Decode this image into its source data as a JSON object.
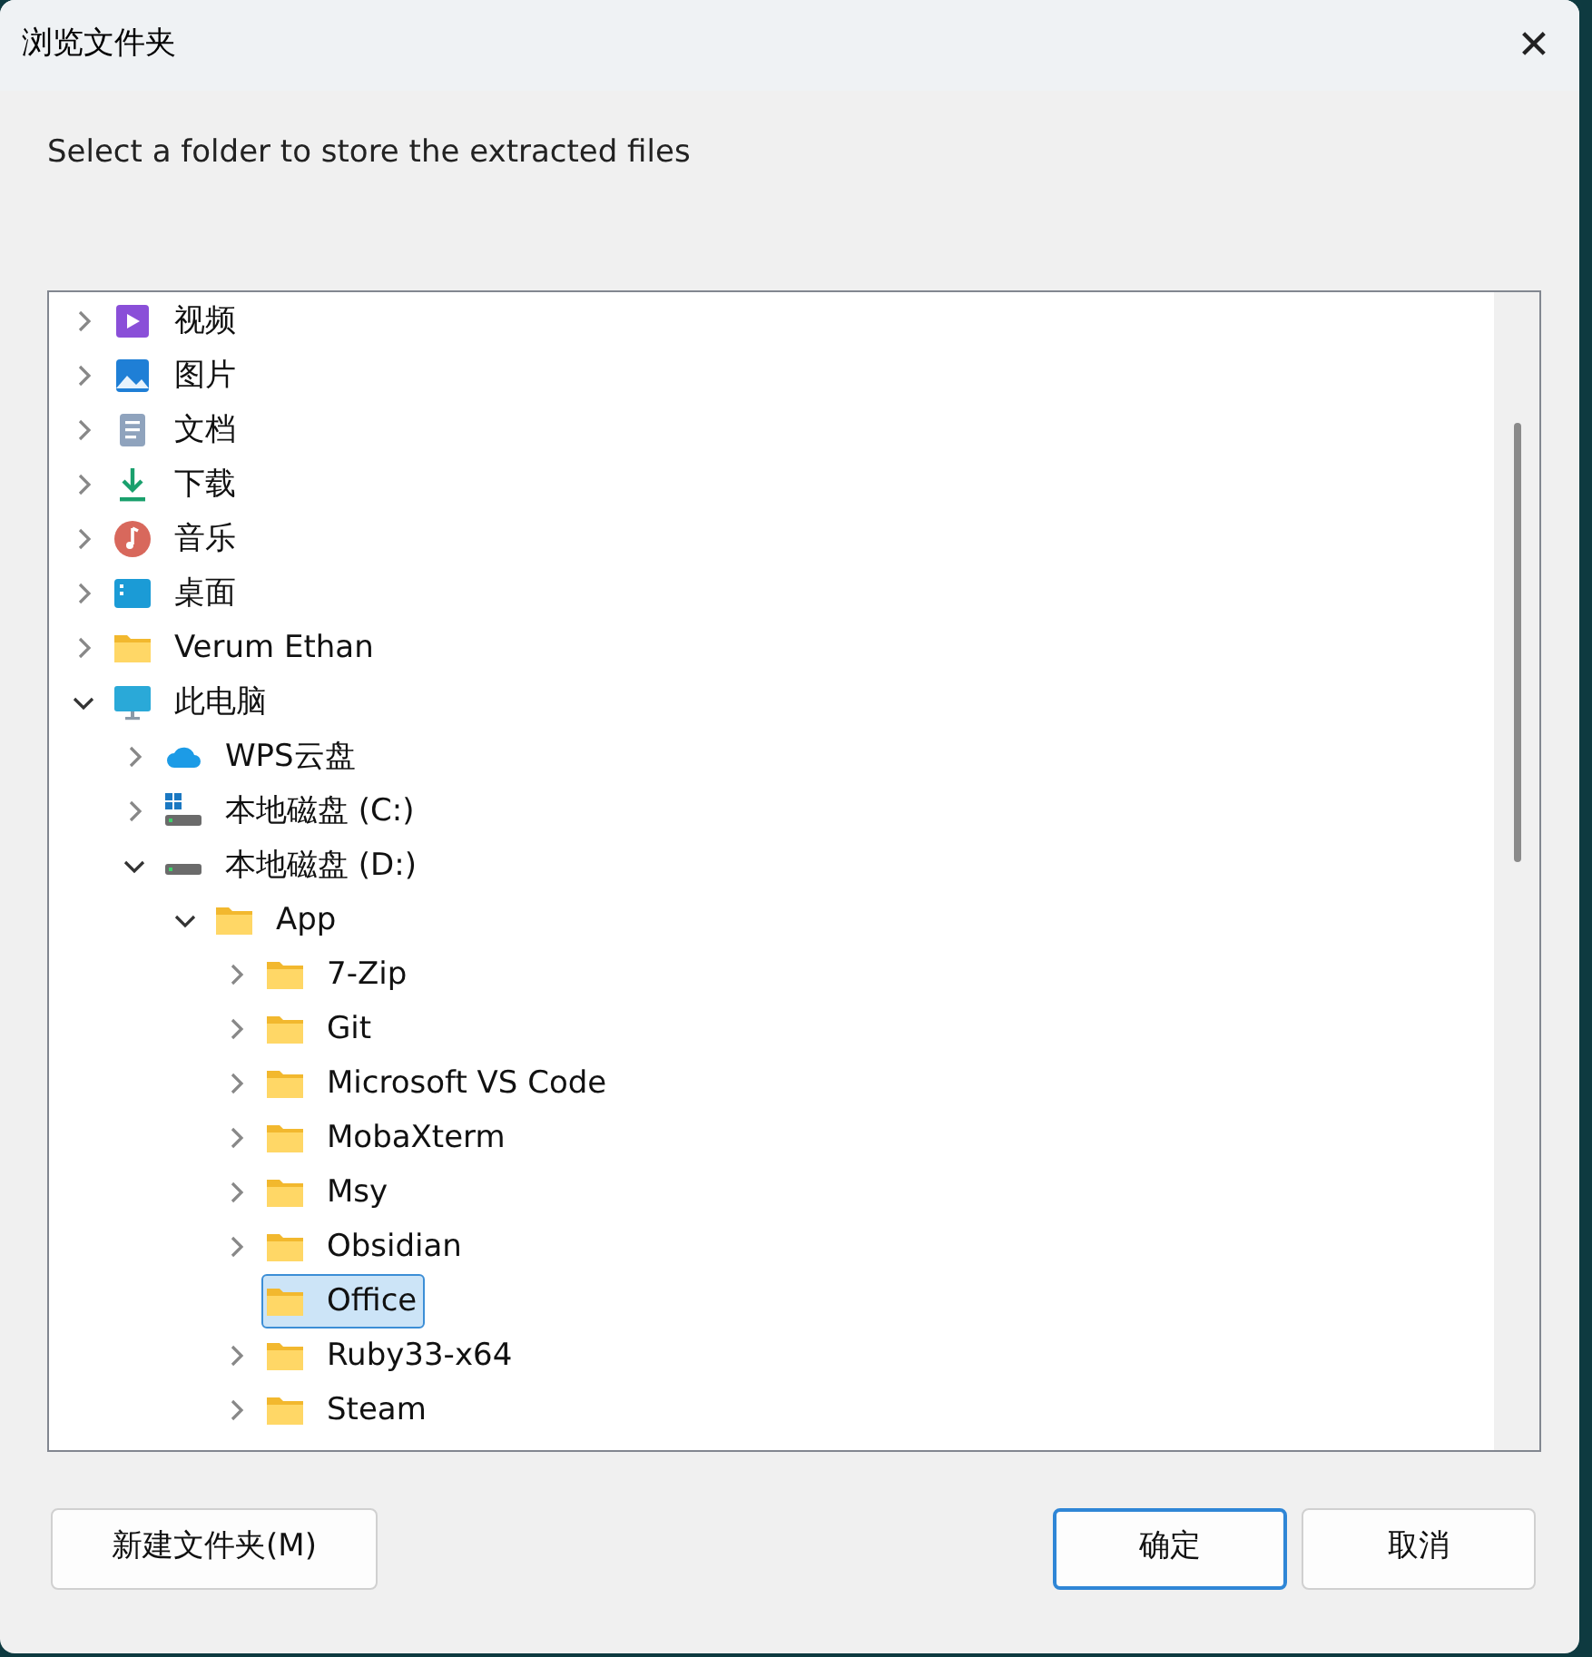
{
  "window": {
    "title": "浏览文件夹",
    "close": "✕"
  },
  "prompt": "Select a folder to store the extracted files",
  "tree": [
    {
      "label": "视频",
      "kind": "video",
      "expanded": false,
      "selected": false
    },
    {
      "label": "图片",
      "kind": "pictures",
      "expanded": false,
      "selected": false
    },
    {
      "label": "文档",
      "kind": "document",
      "expanded": false,
      "selected": false
    },
    {
      "label": "下载",
      "kind": "download",
      "expanded": false,
      "selected": false
    },
    {
      "label": "音乐",
      "kind": "music",
      "expanded": false,
      "selected": false
    },
    {
      "label": "桌面",
      "kind": "desktop",
      "expanded": false,
      "selected": false
    },
    {
      "label": "Verum Ethan",
      "kind": "folder",
      "expanded": false,
      "selected": false
    },
    {
      "label": "此电脑",
      "kind": "monitor",
      "expanded": true,
      "selected": false,
      "children": [
        {
          "label": "WPS云盘",
          "kind": "cloud",
          "expanded": false,
          "selected": false
        },
        {
          "label": "本地磁盘 (C:)",
          "kind": "system-drive",
          "expanded": false,
          "selected": false
        },
        {
          "label": "本地磁盘 (D:)",
          "kind": "drive",
          "expanded": true,
          "selected": false,
          "children": [
            {
              "label": "App",
              "kind": "folder",
              "expanded": true,
              "selected": false,
              "children": [
                {
                  "label": "7-Zip",
                  "kind": "folder",
                  "expanded": false,
                  "selected": false
                },
                {
                  "label": "Git",
                  "kind": "folder",
                  "expanded": false,
                  "selected": false
                },
                {
                  "label": "Microsoft VS Code",
                  "kind": "folder",
                  "expanded": false,
                  "selected": false
                },
                {
                  "label": "MobaXterm",
                  "kind": "folder",
                  "expanded": false,
                  "selected": false
                },
                {
                  "label": "Msy",
                  "kind": "folder",
                  "expanded": false,
                  "selected": false
                },
                {
                  "label": "Obsidian",
                  "kind": "folder",
                  "expanded": false,
                  "selected": false
                },
                {
                  "label": "Office",
                  "kind": "folder",
                  "selected": true
                },
                {
                  "label": "Ruby33-x64",
                  "kind": "folder",
                  "expanded": false,
                  "selected": false
                },
                {
                  "label": "Steam",
                  "kind": "folder",
                  "expanded": false,
                  "selected": false
                }
              ]
            }
          ]
        }
      ]
    }
  ],
  "buttons": [
    {
      "label": "新建文件夹(M)",
      "kind": "secondary"
    },
    {
      "label": "确定",
      "kind": "default"
    },
    {
      "label": "取消",
      "kind": "secondary"
    }
  ]
}
